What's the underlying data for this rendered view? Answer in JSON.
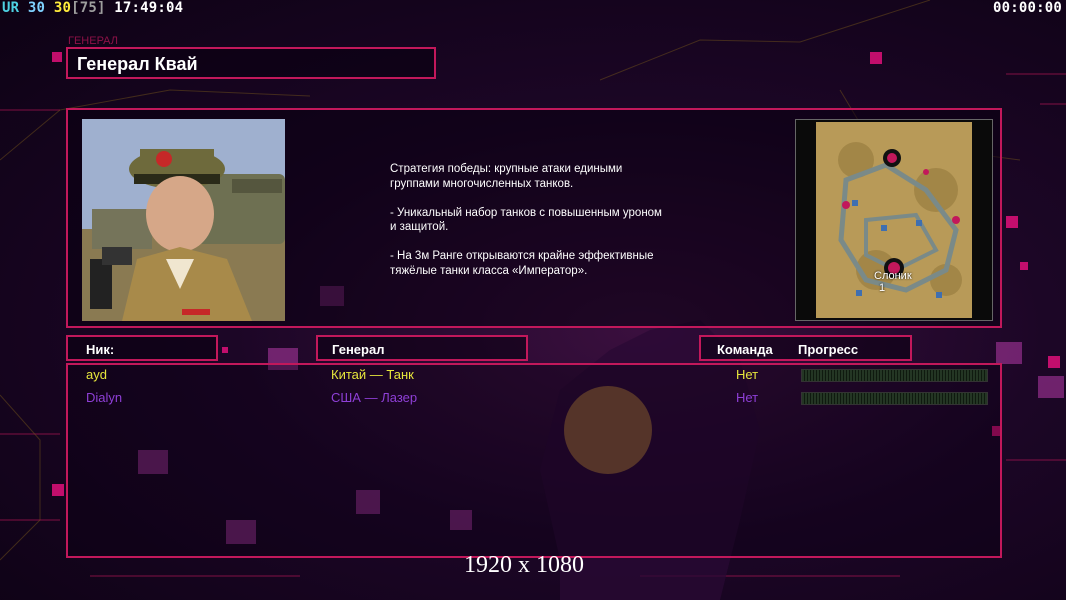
{
  "hud": {
    "ur": "UR",
    "fps_a": "30",
    "fps_b": "30",
    "fps_c": "[75]",
    "clock": "17:49:04",
    "timer": "00:00:00"
  },
  "general": {
    "tag": "ГЕНЕРАЛ",
    "name": "Генерал Квай",
    "description": "Стратегия победы: крупные атаки едиными\n группами многочисленных танков.\n\n- Уникальный набор танков с повышенным уроном\n и защитой.\n\n- На 3м Ранге открываются крайне эффективные\n тяжёлые танки класса «Император».",
    "portrait_icon": "general-kwai-portrait"
  },
  "map": {
    "player_label": "Слоник",
    "player_slot": "1",
    "icon": "minimap"
  },
  "headers": {
    "nick": "Ник:",
    "general": "Генерал",
    "team": "Команда",
    "progress": "Прогресс"
  },
  "players": [
    {
      "nick": "ayd",
      "general": "Китай — Танк",
      "team": "Нет",
      "progress": 0,
      "color": "#e6e63c"
    },
    {
      "nick": "Dialyn",
      "general": "США — Лазер",
      "team": "Нет",
      "progress": 0,
      "color": "#8e3fd6"
    }
  ],
  "resolution": "1920 x 1080",
  "colors": {
    "accent": "#c2185b",
    "player1": "#e6e63c",
    "player2": "#8e3fd6"
  }
}
